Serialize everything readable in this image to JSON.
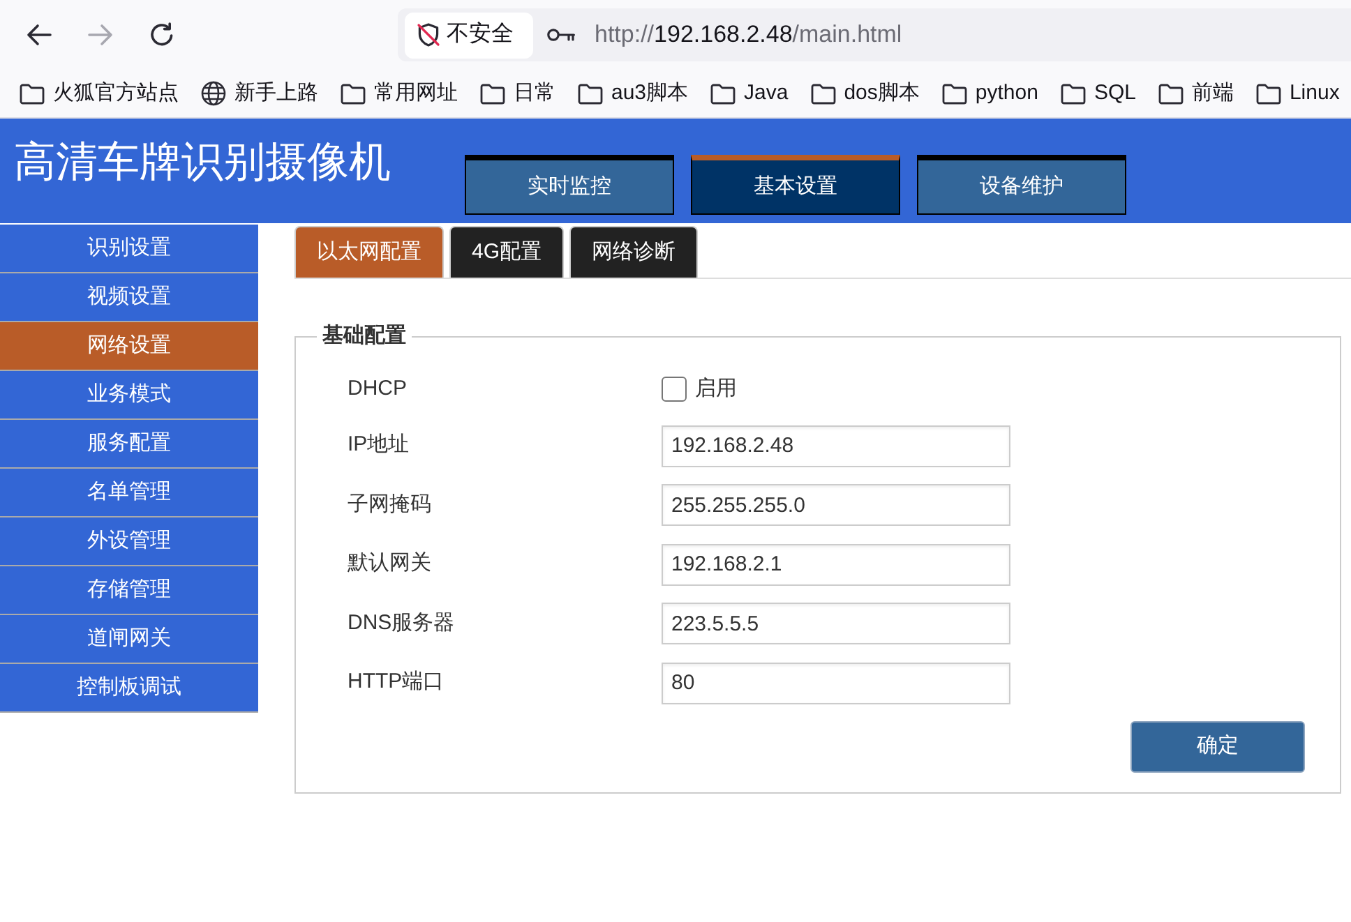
{
  "browser": {
    "toolbar_buttons": [
      {
        "kind": "back",
        "disabled": false
      },
      {
        "kind": "forward",
        "disabled": true
      },
      {
        "kind": "reload",
        "disabled": false
      }
    ],
    "security_label": "不安全",
    "url": {
      "scheme": "http://",
      "host": "192.168.2.48",
      "path": "/main.html"
    },
    "bookmarks": [
      {
        "kind": "folder",
        "label": "火狐官方站点"
      },
      {
        "kind": "link",
        "label": "新手上路"
      },
      {
        "kind": "folder",
        "label": "常用网址"
      },
      {
        "kind": "folder",
        "label": "日常"
      },
      {
        "kind": "folder",
        "label": "au3脚本"
      },
      {
        "kind": "folder",
        "label": "Java"
      },
      {
        "kind": "folder",
        "label": "dos脚本"
      },
      {
        "kind": "folder",
        "label": "python"
      },
      {
        "kind": "folder",
        "label": "SQL"
      },
      {
        "kind": "folder",
        "label": "前端"
      },
      {
        "kind": "folder",
        "label": "Linux"
      }
    ]
  },
  "header": {
    "title": "高清车牌识别摄像机",
    "nav": [
      {
        "label": "实时监控",
        "selected": false
      },
      {
        "label": "基本设置",
        "selected": true
      },
      {
        "label": "设备维护",
        "selected": false
      }
    ]
  },
  "sidebar": {
    "items": [
      {
        "label": "识别设置",
        "selected": false
      },
      {
        "label": "视频设置",
        "selected": false
      },
      {
        "label": "网络设置",
        "selected": true
      },
      {
        "label": "业务模式",
        "selected": false
      },
      {
        "label": "服务配置",
        "selected": false
      },
      {
        "label": "名单管理",
        "selected": false
      },
      {
        "label": "外设管理",
        "selected": false
      },
      {
        "label": "存储管理",
        "selected": false
      },
      {
        "label": "道闸网关",
        "selected": false
      },
      {
        "label": "控制板调试",
        "selected": false
      }
    ]
  },
  "tabs": [
    {
      "label": "以太网配置",
      "selected": true
    },
    {
      "label": "4G配置",
      "selected": false
    },
    {
      "label": "网络诊断",
      "selected": false
    }
  ],
  "form": {
    "legend": "基础配置",
    "rows": [
      {
        "kind": "checkbox",
        "label": "DHCP",
        "checked": false,
        "option_label": "启用"
      },
      {
        "kind": "input",
        "label": "IP地址",
        "value": "192.168.2.48"
      },
      {
        "kind": "input",
        "label": "子网掩码",
        "value": "255.255.255.0"
      },
      {
        "kind": "input",
        "label": "默认网关",
        "value": "192.168.2.1"
      },
      {
        "kind": "input",
        "label": "DNS服务器",
        "value": "223.5.5.5"
      },
      {
        "kind": "input",
        "label": "HTTP端口",
        "value": "80"
      }
    ],
    "submit_label": "确定"
  }
}
